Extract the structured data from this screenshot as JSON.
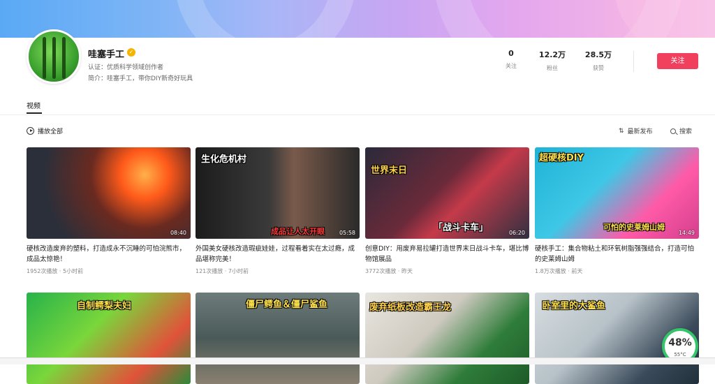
{
  "profile": {
    "name": "哇塞手工",
    "cert_label": "认证：优质科学领域创作者",
    "intro": "简介：哇塞手工，带你DIY新奇好玩具"
  },
  "stats": [
    {
      "num": "0",
      "label": "关注"
    },
    {
      "num": "12.2万",
      "label": "粉丝"
    },
    {
      "num": "28.5万",
      "label": "获赞"
    }
  ],
  "follow_label": "关注",
  "tab_label": "视频",
  "toolbar": {
    "play_all": "播放全部",
    "sort": "最新发布",
    "search": "搜索"
  },
  "videos": [
    {
      "title": "硬核改造废弃的塑料，打造成永不沉睡的可怕浣熊市，成品太惊艳！",
      "meta": "1952次播放 · 5小时前",
      "duration": "08:40",
      "overlay": ""
    },
    {
      "title": "外国美女硬核改造瑕疵娃娃，过程看着实在太过瘾，成品堪称完美！",
      "meta": "121次播放 · 7小时前",
      "duration": "05:58",
      "overlay": "生化危机村",
      "overlay2": "成品让人太开眼"
    },
    {
      "title": "创意DIY：用废弃易拉罐打造世界末日战斗卡车，堪比博物馆展品",
      "meta": "3772次播放 · 昨天",
      "duration": "06:20",
      "overlay": "世界末日",
      "overlay2": "「战斗卡车」"
    },
    {
      "title": "硬核手工：集合物粘土和环氧树脂强强结合，打造可怕的史莱姆山姆",
      "meta": "1.8万次播放 · 前天",
      "duration": "14:49",
      "overlay": "超硬核DIY",
      "overlay2": "可怕的史莱姆山姆"
    },
    {
      "title": "",
      "meta": "",
      "duration": "",
      "overlay": "自制鳄梨夫妇"
    },
    {
      "title": "",
      "meta": "",
      "duration": "",
      "overlay": "僵尸鳄鱼＆僵尸鲨鱼"
    },
    {
      "title": "",
      "meta": "",
      "duration": "",
      "overlay": "废弃纸板改造霸王龙"
    },
    {
      "title": "",
      "meta": "",
      "duration": "",
      "overlay": "卧室里的大鲨鱼"
    }
  ],
  "gauge": {
    "percent": "48%",
    "temp": "55°C"
  }
}
